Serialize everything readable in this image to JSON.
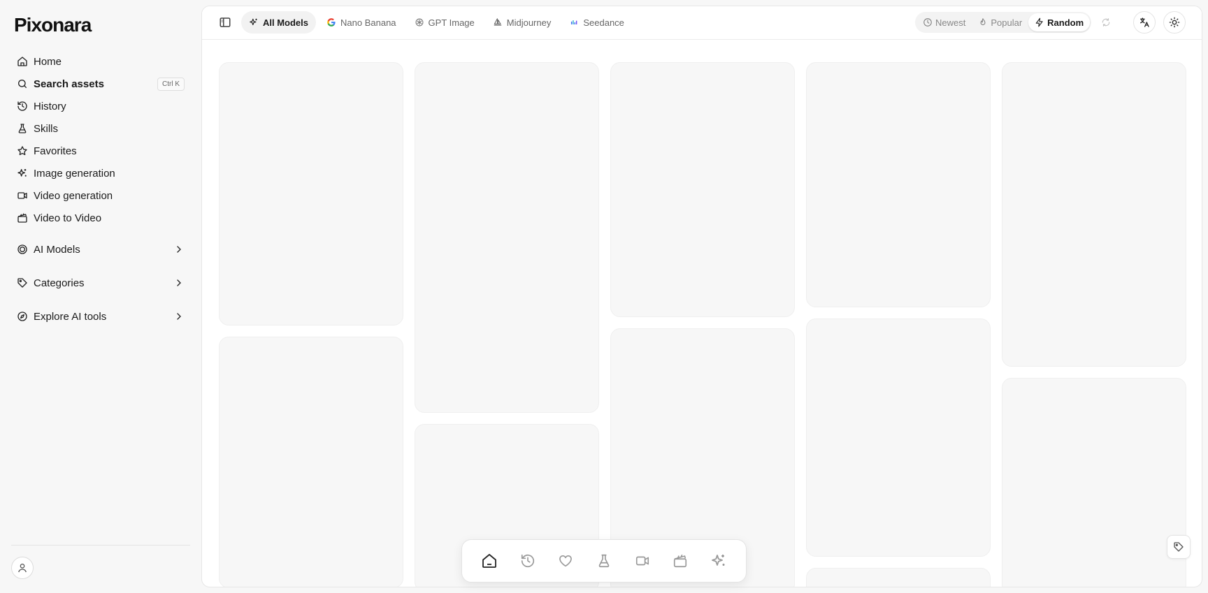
{
  "brand": {
    "name": "Pixonara"
  },
  "sidebar": {
    "items": [
      {
        "label": "Home",
        "icon": "home-icon"
      },
      {
        "label": "Search assets",
        "icon": "search-icon",
        "shortcut": "Ctrl K"
      },
      {
        "label": "History",
        "icon": "history-icon"
      },
      {
        "label": "Skills",
        "icon": "flask-icon"
      },
      {
        "label": "Favorites",
        "icon": "star-icon"
      },
      {
        "label": "Image generation",
        "icon": "sparkles-icon"
      },
      {
        "label": "Video generation",
        "icon": "video-icon"
      },
      {
        "label": "Video to Video",
        "icon": "clapperboard-icon"
      }
    ],
    "groups": [
      {
        "label": "AI Models",
        "icon": "layers-icon"
      },
      {
        "label": "Categories",
        "icon": "tag-icon"
      },
      {
        "label": "Explore AI tools",
        "icon": "compass-icon"
      }
    ]
  },
  "topbar": {
    "model_tabs": [
      {
        "label": "All Models",
        "icon": "sparkles-icon",
        "active": true
      },
      {
        "label": "Nano Banana",
        "icon": "google-icon",
        "active": false
      },
      {
        "label": "GPT Image",
        "icon": "openai-icon",
        "active": false
      },
      {
        "label": "Midjourney",
        "icon": "sailboat-icon",
        "active": false
      },
      {
        "label": "Seedance",
        "icon": "bars-icon",
        "active": false
      }
    ],
    "sort_options": [
      {
        "label": "Newest",
        "icon": "clock-icon",
        "active": false
      },
      {
        "label": "Popular",
        "icon": "flame-icon",
        "active": false
      },
      {
        "label": "Random",
        "icon": "zap-icon",
        "active": true
      }
    ]
  },
  "dock": {
    "buttons": [
      "home-icon",
      "history-icon",
      "heart-icon",
      "flask-icon",
      "video-icon",
      "clapperboard-icon",
      "sparkles-icon"
    ]
  },
  "colors": {
    "skeleton": "#f7f7f7",
    "accent": "#1a1a1a",
    "google_blue": "#4285F4",
    "seedance_blue": "#3b6cf5"
  }
}
